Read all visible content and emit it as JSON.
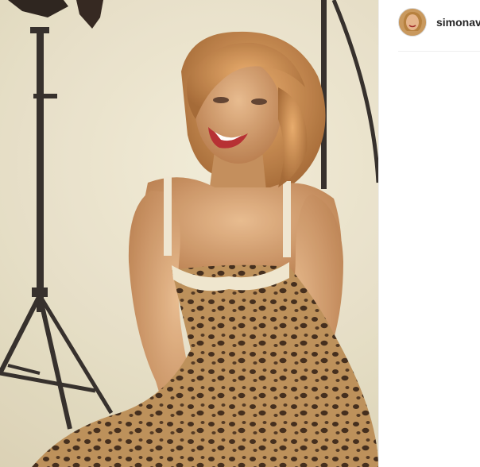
{
  "post": {
    "username": "simonav",
    "photo_alt": "photo"
  },
  "icons": {
    "avatar": "profile-avatar"
  }
}
